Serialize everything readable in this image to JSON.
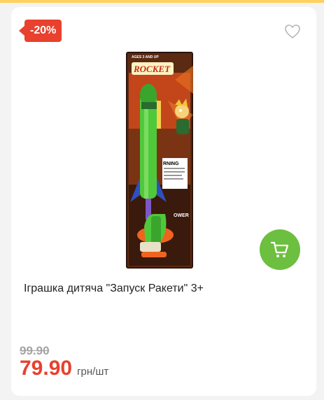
{
  "product": {
    "discount_badge": "-20%",
    "title": "Іграшка дитяча \"Запуск Ракети\" 3+",
    "old_price": "99.90",
    "price": "79.90",
    "unit": "грн/шт",
    "image_text": {
      "age": "AGES 3 AND UP",
      "brand": "ROCKET",
      "warning": "RNING",
      "power": "OWER"
    }
  },
  "icons": {
    "favorite": "heart-icon",
    "cart": "cart-icon"
  },
  "colors": {
    "badge": "#e8412e",
    "price": "#e8412e",
    "cart_button": "#6dbf3f",
    "top_line": "#ffd15c"
  }
}
